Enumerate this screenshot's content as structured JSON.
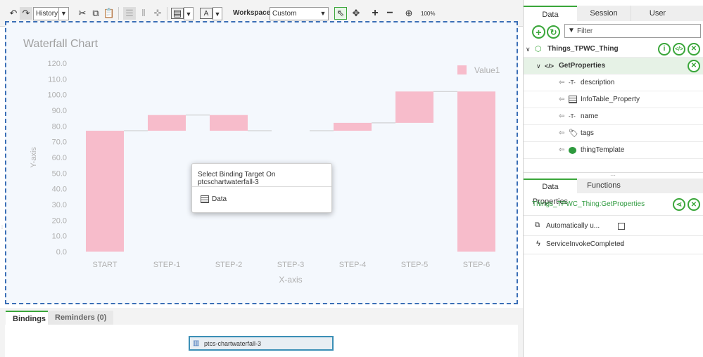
{
  "toolbar": {
    "history_label": "History",
    "workspace_label": "Workspace",
    "workspace_value": "Custom",
    "zoom": "100%"
  },
  "popup": {
    "title": "Select Binding Target On ptcschartwaterfall-3",
    "item": "Data"
  },
  "bottom": {
    "tabs": [
      "Bindings",
      "Reminders (0)"
    ],
    "widget_label": "ptcs-chartwaterfall-3"
  },
  "right": {
    "tabs": [
      "Data",
      "Session",
      "User"
    ],
    "filter_placeholder": "Filter",
    "thing": "Things_TPWC_Thing",
    "service": "GetProperties",
    "fields": [
      "description",
      "InfoTable_Property",
      "name",
      "tags",
      "thingTemplate"
    ],
    "props_tabs": [
      "Data Properties",
      "Functions"
    ],
    "props_title": "Things_TPWC_Thing:GetProperties",
    "auto_label": "Automatically u...",
    "event_label": "ServiceInvokeCompleted"
  },
  "chart_data": {
    "type": "bar",
    "title": "Waterfall Chart",
    "xlabel": "X-axis",
    "ylabel": "Y-axis",
    "ylim": [
      0,
      120
    ],
    "yticks": [
      "120.0",
      "110.0",
      "100.0",
      "90.0",
      "80.0",
      "70.0",
      "60.0",
      "50.0",
      "40.0",
      "30.0",
      "20.0",
      "10.0",
      "0.0"
    ],
    "categories": [
      "START",
      "STEP-1",
      "STEP-2",
      "STEP-3",
      "STEP-4",
      "STEP-5",
      "STEP-6"
    ],
    "series": [
      {
        "name": "Value1",
        "values": [
          77,
          10,
          -10,
          0,
          5,
          20,
          102
        ]
      }
    ],
    "bar_color": "#f7bccb",
    "legend": "top-right"
  }
}
